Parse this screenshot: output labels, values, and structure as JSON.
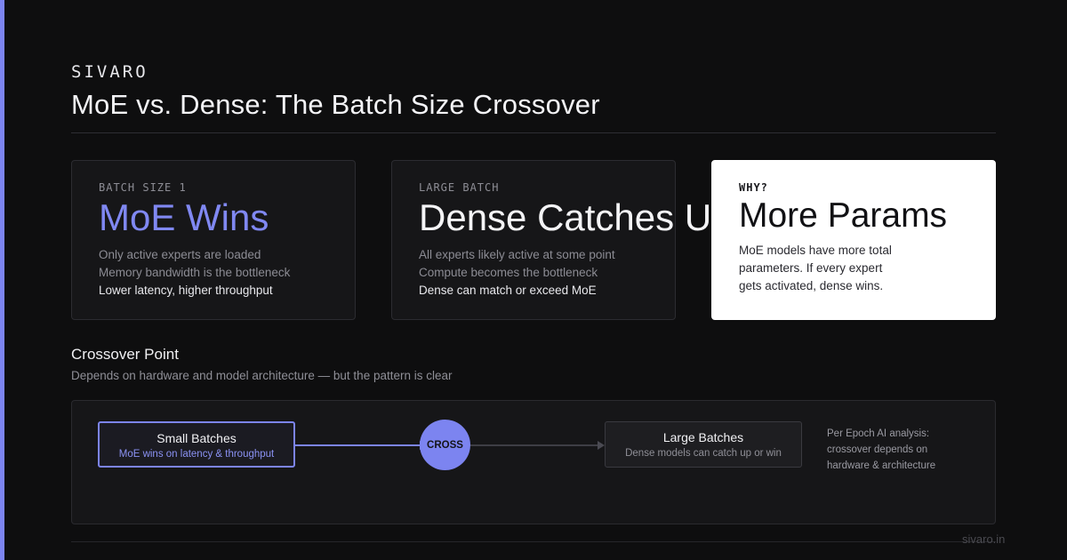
{
  "brand": "SIVARO",
  "title": "MoE vs. Dense: The Batch Size Crossover",
  "cards": [
    {
      "tag": "BATCH SIZE 1",
      "headline": "MoE Wins",
      "lines": [
        "Only active experts are loaded",
        "Memory bandwidth is the bottleneck",
        "Lower latency, higher throughput"
      ]
    },
    {
      "tag": "LARGE BATCH",
      "headline": "Dense Catches Up",
      "lines": [
        "All experts likely active at some point",
        "Compute becomes the bottleneck",
        "Dense can match or exceed MoE"
      ]
    },
    {
      "tag": "WHY?",
      "headline": "More Params",
      "body": "MoE models have more total parameters. If every expert gets activated, dense wins."
    }
  ],
  "crossover": {
    "title": "Crossover Point",
    "subtitle": "Depends on hardware and model architecture — but the pattern is clear"
  },
  "diagram": {
    "small": {
      "title": "Small Batches",
      "sub": "MoE wins on latency & throughput"
    },
    "cross": "CROSS",
    "large": {
      "title": "Large Batches",
      "sub": "Dense models can catch up or win"
    },
    "note": "Per Epoch AI analysis: crossover depends on hardware & architecture"
  },
  "footer": "sivaro.in",
  "colors": {
    "accent": "#7c84f0",
    "background": "#0e0e0f",
    "card": "#161618"
  }
}
